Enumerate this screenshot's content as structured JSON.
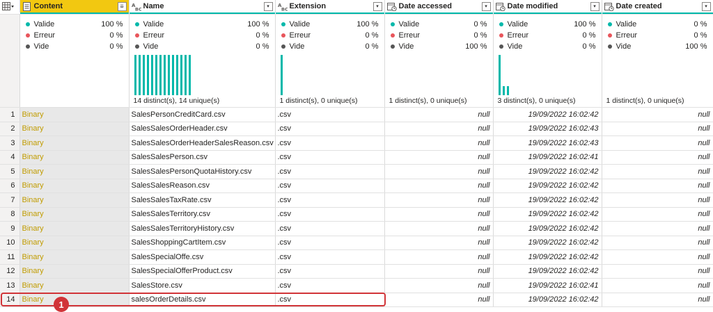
{
  "columns": [
    {
      "key": "content",
      "name": "Content",
      "type_icon": "binary-type-icon",
      "button": "expand-icon",
      "button_glyph": "⇊"
    },
    {
      "key": "name",
      "name": "Name",
      "type_icon": "text-type-icon",
      "button": "dropdown-icon",
      "button_glyph": "▾"
    },
    {
      "key": "extension",
      "name": "Extension",
      "type_icon": "text-type-icon",
      "button": "dropdown-icon",
      "button_glyph": "▾"
    },
    {
      "key": "date_accessed",
      "name": "Date accessed",
      "type_icon": "datetime-type-icon",
      "button": "dropdown-icon",
      "button_glyph": "▾"
    },
    {
      "key": "date_modified",
      "name": "Date modified",
      "type_icon": "datetime-type-icon",
      "button": "dropdown-icon",
      "button_glyph": "▾"
    },
    {
      "key": "date_created",
      "name": "Date created",
      "type_icon": "datetime-type-icon",
      "button": "dropdown-icon",
      "button_glyph": "▾"
    }
  ],
  "quality_labels": {
    "valid": "Valide",
    "error": "Erreur",
    "empty": "Vide"
  },
  "quality_colors": {
    "valid": "#01b8aa",
    "error": "#e8555b",
    "empty": "#555555"
  },
  "profiles": [
    {
      "valid": "100 %",
      "error": "0 %",
      "empty": "0 %",
      "distinct": "",
      "histogram": []
    },
    {
      "valid": "100 %",
      "error": "0 %",
      "empty": "0 %",
      "distinct": "14 distinct(s), 14 unique(s)",
      "histogram": [
        1,
        1,
        1,
        1,
        1,
        1,
        1,
        1,
        1,
        1,
        1,
        1,
        1,
        1
      ]
    },
    {
      "valid": "100 %",
      "error": "0 %",
      "empty": "0 %",
      "distinct": "1 distinct(s), 0 unique(s)",
      "histogram": [
        1
      ]
    },
    {
      "valid": "0 %",
      "error": "0 %",
      "empty": "100 %",
      "distinct": "1 distinct(s), 0 unique(s)",
      "histogram": []
    },
    {
      "valid": "100 %",
      "error": "0 %",
      "empty": "0 %",
      "distinct": "3 distinct(s), 0 unique(s)",
      "histogram": [
        1,
        0.22,
        0.22
      ]
    },
    {
      "valid": "0 %",
      "error": "0 %",
      "empty": "100 %",
      "distinct": "1 distinct(s), 0 unique(s)",
      "histogram": []
    }
  ],
  "rows": [
    {
      "n": "1",
      "content": "Binary",
      "name": "SalesPersonCreditCard.csv",
      "extension": ".csv",
      "date_accessed": "null",
      "date_modified": "19/09/2022 16:02:42",
      "date_created": "null"
    },
    {
      "n": "2",
      "content": "Binary",
      "name": "SalesSalesOrderHeader.csv",
      "extension": ".csv",
      "date_accessed": "null",
      "date_modified": "19/09/2022 16:02:43",
      "date_created": "null"
    },
    {
      "n": "3",
      "content": "Binary",
      "name": "SalesSalesOrderHeaderSalesReason.csv",
      "extension": ".csv",
      "date_accessed": "null",
      "date_modified": "19/09/2022 16:02:43",
      "date_created": "null"
    },
    {
      "n": "4",
      "content": "Binary",
      "name": "SalesSalesPerson.csv",
      "extension": ".csv",
      "date_accessed": "null",
      "date_modified": "19/09/2022 16:02:41",
      "date_created": "null"
    },
    {
      "n": "5",
      "content": "Binary",
      "name": "SalesSalesPersonQuotaHistory.csv",
      "extension": ".csv",
      "date_accessed": "null",
      "date_modified": "19/09/2022 16:02:42",
      "date_created": "null"
    },
    {
      "n": "6",
      "content": "Binary",
      "name": "SalesSalesReason.csv",
      "extension": ".csv",
      "date_accessed": "null",
      "date_modified": "19/09/2022 16:02:42",
      "date_created": "null"
    },
    {
      "n": "7",
      "content": "Binary",
      "name": "SalesSalesTaxRate.csv",
      "extension": ".csv",
      "date_accessed": "null",
      "date_modified": "19/09/2022 16:02:42",
      "date_created": "null"
    },
    {
      "n": "8",
      "content": "Binary",
      "name": "SalesSalesTerritory.csv",
      "extension": ".csv",
      "date_accessed": "null",
      "date_modified": "19/09/2022 16:02:42",
      "date_created": "null"
    },
    {
      "n": "9",
      "content": "Binary",
      "name": "SalesSalesTerritoryHistory.csv",
      "extension": ".csv",
      "date_accessed": "null",
      "date_modified": "19/09/2022 16:02:42",
      "date_created": "null"
    },
    {
      "n": "10",
      "content": "Binary",
      "name": "SalesShoppingCartItem.csv",
      "extension": ".csv",
      "date_accessed": "null",
      "date_modified": "19/09/2022 16:02:42",
      "date_created": "null"
    },
    {
      "n": "11",
      "content": "Binary",
      "name": "SalesSpecialOffe.csv",
      "extension": ".csv",
      "date_accessed": "null",
      "date_modified": "19/09/2022 16:02:42",
      "date_created": "null"
    },
    {
      "n": "12",
      "content": "Binary",
      "name": "SalesSpecialOfferProduct.csv",
      "extension": ".csv",
      "date_accessed": "null",
      "date_modified": "19/09/2022 16:02:42",
      "date_created": "null"
    },
    {
      "n": "13",
      "content": "Binary",
      "name": "SalesStore.csv",
      "extension": ".csv",
      "date_accessed": "null",
      "date_modified": "19/09/2022 16:02:41",
      "date_created": "null"
    },
    {
      "n": "14",
      "content": "Binary",
      "name": "salesOrderDetails.csv",
      "extension": ".csv",
      "date_accessed": "null",
      "date_modified": "19/09/2022 16:02:42",
      "date_created": "null"
    }
  ],
  "callout": {
    "number": "1",
    "color": "#d13438"
  }
}
